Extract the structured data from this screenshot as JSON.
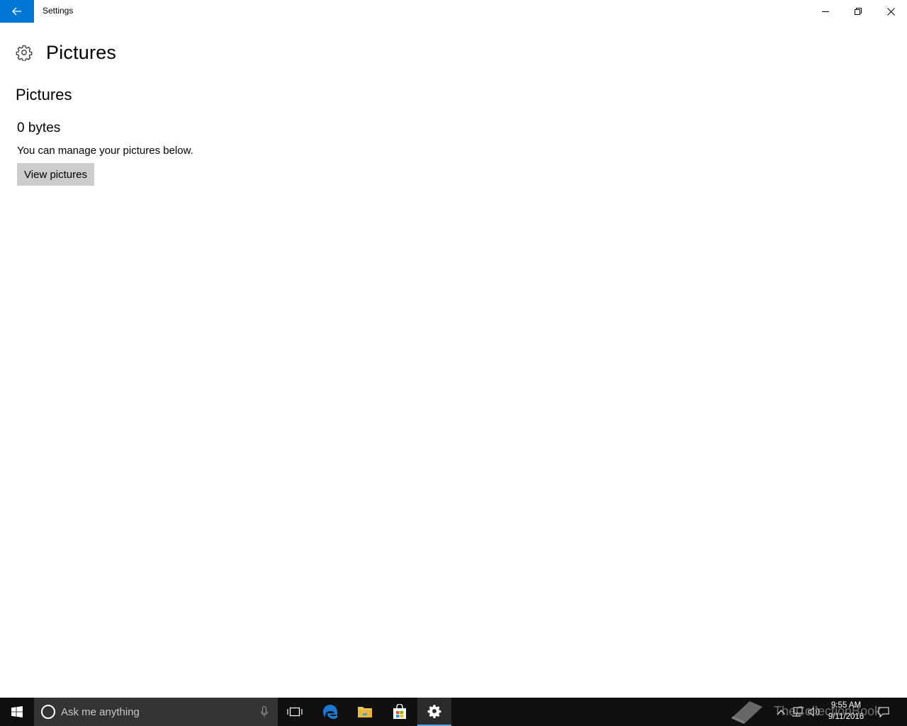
{
  "window": {
    "title": "Settings"
  },
  "page": {
    "title": "Pictures",
    "section_title": "Pictures",
    "size_value": "0 bytes",
    "description": "You can manage your pictures below.",
    "view_button_label": "View pictures"
  },
  "taskbar": {
    "search_placeholder": "Ask me anything",
    "time": "9:55 AM",
    "date": "9/11/2016",
    "watermark": "TheCollectionBook"
  },
  "colors": {
    "accent": "#0078d7",
    "taskbar": "#101010",
    "search_box": "#333333",
    "button_gray": "#cccccc"
  }
}
